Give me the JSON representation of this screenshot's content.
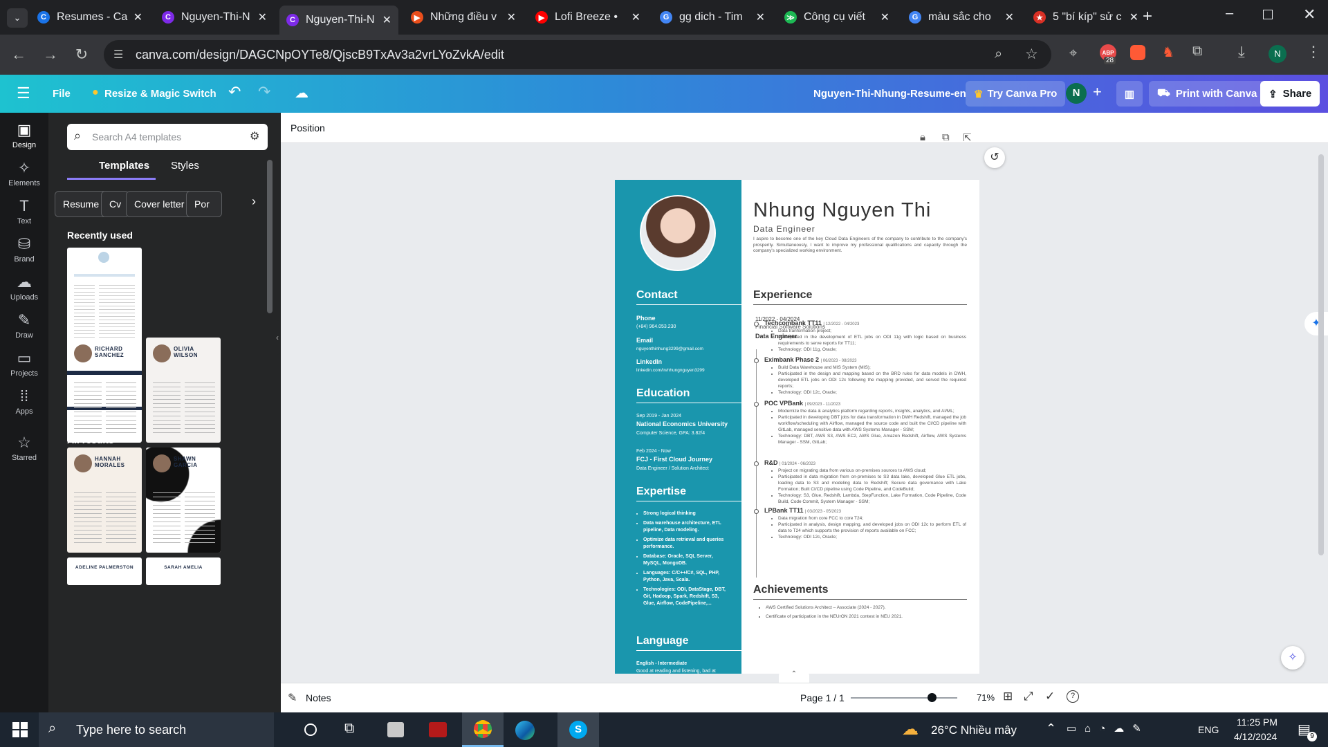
{
  "browser": {
    "tabs": [
      {
        "title": "Resumes - Ca",
        "fav": "C",
        "color": "#1a73e8"
      },
      {
        "title": "Nguyen-Thi-N",
        "fav": "C",
        "color": "#7d2ae8"
      },
      {
        "title": "Nguyen-Thi-N",
        "fav": "C",
        "color": "#7d2ae8",
        "active": true
      },
      {
        "title": "Những điều v",
        "fav": "▶",
        "color": "#e94e1b"
      },
      {
        "title": "Lofi Breeze •",
        "fav": "▶",
        "color": "#ff0000"
      },
      {
        "title": "gg dich - Tim",
        "fav": "G",
        "color": "#4285f4"
      },
      {
        "title": "Công cụ viết",
        "fav": "≫",
        "color": "#1db954"
      },
      {
        "title": "màu sắc cho",
        "fav": "G",
        "color": "#4285f4"
      },
      {
        "title": "5 \"bí kíp\" sử c",
        "fav": "★",
        "color": "#d93025"
      }
    ],
    "url": "canva.com/design/DAGCNpOYTe8/QjscB9TxAv3a2vrLYoZvkA/edit",
    "badge_count": "28",
    "profile_initial": "N"
  },
  "canva": {
    "file_label": "File",
    "resize_label": "Resize & Magic Switch",
    "doc_title": "Nguyen-Thi-Nhung-Resume-en",
    "try_pro": "Try Canva Pro",
    "avatar_initial": "N",
    "print_label": "Print with Canva",
    "share_label": "Share",
    "position_label": "Position",
    "notes_label": "Notes",
    "page_label": "Page 1 / 1",
    "zoom_label": "71%",
    "zoom_value": 0.71
  },
  "rail": [
    {
      "label": "Design",
      "icon": "▣"
    },
    {
      "label": "Elements",
      "icon": "✧"
    },
    {
      "label": "Text",
      "icon": "T"
    },
    {
      "label": "Brand",
      "icon": "⛁"
    },
    {
      "label": "Uploads",
      "icon": "☁"
    },
    {
      "label": "Draw",
      "icon": "✎"
    },
    {
      "label": "Projects",
      "icon": "▭"
    },
    {
      "label": "Apps",
      "icon": "⁞⁞"
    },
    {
      "label": "Starred",
      "icon": "☆"
    }
  ],
  "panel": {
    "search_placeholder": "Search A4 templates",
    "tab_templates": "Templates",
    "tab_styles": "Styles",
    "chips": [
      "Resume",
      "Cv",
      "Cover letter",
      "Por"
    ],
    "recently_used": "Recently used",
    "all_results": "All results",
    "thumbs": [
      {
        "name": "RICHARD SANCHEZ"
      },
      {
        "name": "OLIVIA WILSON"
      },
      {
        "name": "HANNAH MORALES"
      },
      {
        "name": "SHAWN GARCIA"
      },
      {
        "name": "ADELINE PALMERSTON"
      },
      {
        "name": "SARAH AMELIA"
      }
    ]
  },
  "resume": {
    "name": "Nhung Nguyen Thi",
    "role": "Data Engineer",
    "summary": "I aspire to become one of the key Cloud Data Engineers of the company to contribute to the company's prosperity. Simultaneously, I want to improve my professional qualifications and capacity through the company's specialized working environment.",
    "contact_h": "Contact",
    "phone_l": "Phone",
    "phone": "(+84) 964.053.230",
    "email_l": "Email",
    "email": "nguyenthinhung3299@gmail.com",
    "linkedin_l": "LinkedIn",
    "linkedin": "linkedin.com/in/nhungnguyen3299",
    "education_h": "Education",
    "edu1_date": "Sep 2019 - Jan 2024",
    "edu1_school": "National Economics University",
    "edu1_detail": "Computer Science, GPA: 3.82/4",
    "edu2_date": "Feb 2024 - Now",
    "edu2_school": "FCJ - First Cloud Journey",
    "edu2_detail": "Data Engineer / Solution Architect",
    "expertise_h": "Expertise",
    "expertise": [
      "Strong logical thinking",
      "Data warehouse architecture, ETL pipeline, Data modeling.",
      "Optimize data retrieval and queries performance.",
      "Database: Oracle, SQL Server, MySQL, MongoDB.",
      "Languages: C/C++/C#, SQL, PHP, Python, Java, Scala.",
      "Technologies: ODI, DataStage, DBT, Git, Hadoop, Spark, Redshift, S3, Glue, Airflow, CodePipeline,..."
    ],
    "language_h": "Language",
    "lang1": "English - Intermediate",
    "lang2": "Good at reading and listening, bad at",
    "experience_h": "Experience",
    "exp_date": "11/2022 - 04/2024",
    "exp_company": "Financial Software Solutions",
    "exp_role": "Data Engineer",
    "projects": [
      {
        "title": "Techcombank TT11",
        "date": "| 12/2022 - 04/2023",
        "bullets": [
          "Data tranformation project;",
          "Participated in the development of ETL jobs on ODI 11g with logic based on business requirements to serve reports for TT11;",
          "Technology: ODI 11g, Oracle;"
        ]
      },
      {
        "title": "Eximbank Phase 2",
        "date": "| 06/2023 - 08/2023",
        "bullets": [
          "Build Data Warehouse and MIS System (MIS);",
          "Participated in the design and mapping based on the BRD rules for data models in DWH, developed ETL jobs on ODI 12c following the mapping provided, and served the required reports;",
          "Technology: ODI 12c, Oracle;"
        ]
      },
      {
        "title": "POC VPBank",
        "date": "| 09/2023 - 11/2023",
        "bullets": [
          "Modernize the data & analytics platform regarding reports, insights, analytics, and AI/ML;",
          "Participated in developing DBT jobs for data transformation in DWH Redshift, managed the job workflow/scheduling with Airflow, managed the source code and built the CI/CD pipeline with GitLab, managed sensitive data with AWS Systems Manager - SSM;",
          "Technology: DBT, AWS S3, AWS EC2, AWS Glue, Amazon Redshift, Airflow, AWS Systems Manager - SSM, GitLab;"
        ]
      },
      {
        "title": "R&D",
        "date": "| 01/2024 - 06/2023",
        "bullets": [
          "Project on migrating data from various on-premises sources to AWS cloud;",
          "Participated in data migration from on-premises to S3 data lake, developed Glue ETL jobs, loading data to S3 and modeling data to Redshift; Secure data governance with Lake Formation; Built CI/CD pipeline using Code Pipeline, and CodeBuild;",
          "Technology: S3, Glue, Redshift, Lambda, StepFunction, Lake Formation, Code Pipeline, Code Build, Code Commit, System Manager - SSM;"
        ]
      },
      {
        "title": "LPBank TT11",
        "date": "| 03/2023 - 05/2023",
        "bullets": [
          "Data migration from core FCC to core T24;",
          "Participated in analysis, design mapping, and developed jobs on ODI 12c to perform ETL of data to T24 which supports the provision of reports available on FCC;",
          "Technology: ODI 12c, Oracle;"
        ]
      }
    ],
    "achievements_h": "Achievements",
    "achievements": [
      "AWS Certified Solutions Architect – Associate (2024 - 2027).",
      "Certificate of participation in the NEUrON 2021 contest in NEU 2021."
    ]
  },
  "taskbar": {
    "search_placeholder": "Type here to search",
    "weather": "26°C  Nhiều mây",
    "lang": "ENG",
    "time": "11:25 PM",
    "date": "4/12/2024",
    "notif_count": "9"
  }
}
